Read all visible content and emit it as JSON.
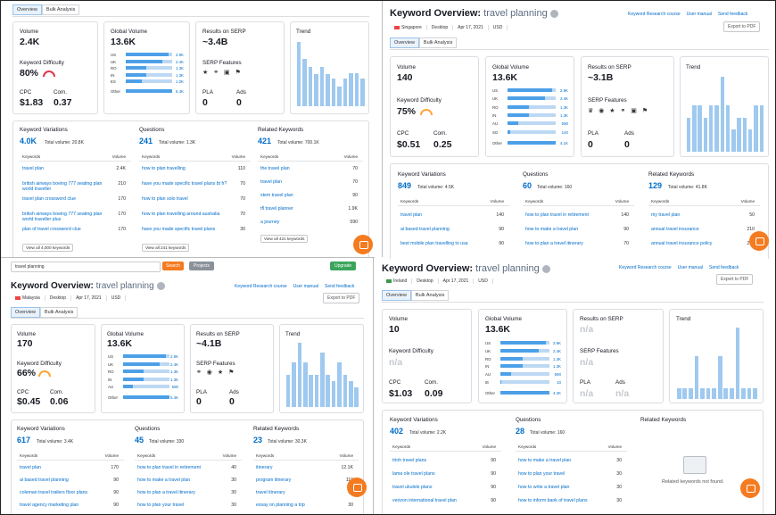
{
  "common": {
    "title_prefix": "Keyword Overview:",
    "keyword": "travel planning",
    "tab_overview": "Overview",
    "tab_bulk": "Bulk Analysis",
    "lbl_volume": "Volume",
    "lbl_global": "Global Volume",
    "lbl_results": "Results on SERP",
    "lbl_trend": "Trend",
    "lbl_kd": "Keyword Difficulty",
    "lbl_serp_features": "SERP Features",
    "lbl_cpc": "CPC",
    "lbl_com": "Com.",
    "lbl_pla": "PLA",
    "lbl_ads": "Ads",
    "lbl_variations": "Keyword Variations",
    "lbl_questions": "Questions",
    "lbl_related": "Related Keywords",
    "col_keywords": "Keywords",
    "col_volume": "Volume",
    "link_research": "Keyword Research course",
    "link_manual": "User manual",
    "link_feedback": "Send feedback",
    "export": "Export to PDF",
    "na": "n/a",
    "other": "Other",
    "icon_names": [
      "search-icon",
      "chat-icon",
      "flag-icon",
      "info-icon",
      "gauge-icon"
    ],
    "colors": {
      "link": "#006dca",
      "bar": "#9fc9ef",
      "gauge_orange": "#ffa43c",
      "gauge_red": "#e0384b",
      "chat": "#f57b20"
    }
  },
  "p1": {
    "volume": "2.4K",
    "global": "13.6K",
    "results": "~3.4B",
    "kd": "80%",
    "cpc": "$1.83",
    "com": "0.37",
    "pla": "0",
    "ads": "0",
    "countries": [
      {
        "code": "US",
        "val": "2.9K",
        "pct": 0.92
      },
      {
        "code": "UK",
        "val": "2.4K",
        "pct": 0.78
      },
      {
        "code": "RO",
        "val": "1.3K",
        "pct": 0.45
      },
      {
        "code": "IN",
        "val": "1.3K",
        "pct": 0.45
      },
      {
        "code": "ES",
        "val": "1.0K",
        "pct": 0.35
      },
      {
        "code": "Other",
        "val": "5.4K",
        "pct": 1.0
      }
    ],
    "trend": [
      0.97,
      0.72,
      0.6,
      0.48,
      0.6,
      0.48,
      0.42,
      0.3,
      0.42,
      0.5,
      0.5,
      0.42
    ],
    "variations": {
      "count": "4.0K",
      "total": "Total volume: 20.8K",
      "rows": [
        {
          "k": "travel plan",
          "v": "2.4K"
        },
        {
          "k": "british airways boeing 777 seating plan world traveller",
          "v": "210"
        },
        {
          "k": "travel plan crossword clue",
          "v": "170"
        },
        {
          "k": "british airways boeing 777 seating plan world traveller plus",
          "v": "170"
        },
        {
          "k": "plan of travel crossword clue",
          "v": "170"
        }
      ],
      "btn": "View all 4,000 keywords"
    },
    "questions": {
      "count": "241",
      "total": "Total volume: 1.3K",
      "rows": [
        {
          "k": "how to plan travelling",
          "v": "110"
        },
        {
          "k": "have you made specific travel plans bt fr?",
          "v": "70"
        },
        {
          "k": "how to plan solo travel",
          "v": "70"
        },
        {
          "k": "how to plan travelling around australia",
          "v": "70"
        },
        {
          "k": "have you made specific travel plans",
          "v": "30"
        }
      ],
      "btn": "View all 241 keywords"
    },
    "related": {
      "count": "421",
      "total": "Total volume: 700.1K",
      "rows": [
        {
          "k": "the travel plan",
          "v": "70"
        },
        {
          "k": "travel plan",
          "v": "70"
        },
        {
          "k": "stem travel plan",
          "v": "90"
        },
        {
          "k": "tfl travel planner",
          "v": "1.9K"
        },
        {
          "k": "a journey",
          "v": "590"
        }
      ],
      "btn": "View all 421 keywords"
    }
  },
  "p2": {
    "filters": [
      "Singapore",
      "Desktop",
      "Apr 17, 2021",
      "USD"
    ],
    "volume": "140",
    "global": "13.6K",
    "results": "~3.1B",
    "kd": "75%",
    "cpc": "$0.51",
    "com": "0.25",
    "pla": "0",
    "ads": "0",
    "countries": [
      {
        "code": "US",
        "val": "2.9K",
        "pct": 0.92
      },
      {
        "code": "UK",
        "val": "2.4K",
        "pct": 0.78
      },
      {
        "code": "RO",
        "val": "1.3K",
        "pct": 0.45
      },
      {
        "code": "IN",
        "val": "1.3K",
        "pct": 0.45
      },
      {
        "code": "AU",
        "val": "590",
        "pct": 0.22
      },
      {
        "code": "SG",
        "val": "140",
        "pct": 0.06
      },
      {
        "code": "Other",
        "val": "4.1K",
        "pct": 1.0
      }
    ],
    "trend": [
      0.45,
      0.62,
      0.62,
      0.45,
      0.62,
      0.62,
      1.0,
      0.62,
      0.3,
      0.45,
      0.45,
      0.3,
      0.62,
      0.62
    ],
    "variations": {
      "count": "849",
      "total": "Total volume: 4.5K",
      "rows": [
        {
          "k": "travel plan",
          "v": "140"
        },
        {
          "k": "ai based travel planning",
          "v": "90"
        },
        {
          "k": "best mobile plan travelling to usa",
          "v": "90"
        }
      ]
    },
    "questions": {
      "count": "60",
      "total": "Total volume: 160",
      "rows": [
        {
          "k": "how to plan travel in retirement",
          "v": "140"
        },
        {
          "k": "how to make a travel plan",
          "v": "90"
        },
        {
          "k": "how to plan a travel itinerary",
          "v": "70"
        }
      ]
    },
    "related": {
      "count": "129",
      "total": "Total volume: 41.8K",
      "rows": [
        {
          "k": "my travel plan",
          "v": "50"
        },
        {
          "k": "annual travel insurance",
          "v": "210"
        },
        {
          "k": "annual travel insurance policy",
          "v": "210"
        }
      ]
    }
  },
  "p3": {
    "search_value": "travel planning",
    "search_btn": "Search",
    "projects_btn": "Projects",
    "upgrade_btn": "Upgrade",
    "filters": [
      "Malaysia",
      "Desktop",
      "Apr 17, 2021",
      "USD"
    ],
    "volume": "170",
    "global": "13.6K",
    "results": "~4.1B",
    "kd": "66%",
    "cpc": "$0.45",
    "com": "0.06",
    "pla": "0",
    "ads": "0",
    "countries": [
      {
        "code": "US",
        "val": "2.9K",
        "pct": 0.92
      },
      {
        "code": "UK",
        "val": "2.4K",
        "pct": 0.78
      },
      {
        "code": "RO",
        "val": "1.3K",
        "pct": 0.45
      },
      {
        "code": "IN",
        "val": "1.3K",
        "pct": 0.45
      },
      {
        "code": "AU",
        "val": "590",
        "pct": 0.22
      },
      {
        "code": "Other",
        "val": "5.4K",
        "pct": 1.0
      }
    ],
    "trend": [
      0.5,
      0.7,
      1.0,
      0.7,
      0.5,
      0.5,
      0.85,
      0.5,
      0.4,
      0.7,
      0.5,
      0.4,
      0.3
    ],
    "variations": {
      "count": "617",
      "total": "Total volume: 3.4K",
      "rows": [
        {
          "k": "travel plan",
          "v": "170"
        },
        {
          "k": "ai based travel planning",
          "v": "90"
        },
        {
          "k": "coleman travel trailers floor plans",
          "v": "90"
        },
        {
          "k": "travel agency marketing plan",
          "v": "90"
        }
      ]
    },
    "questions": {
      "count": "45",
      "total": "Total volume: 330",
      "rows": [
        {
          "k": "how to plan travel in retirement",
          "v": "40"
        },
        {
          "k": "how to make a travel plan",
          "v": "30"
        },
        {
          "k": "how to plan a travel itinerary",
          "v": "30"
        },
        {
          "k": "how to plan your travel",
          "v": "30"
        }
      ]
    },
    "related": {
      "count": "23",
      "total": "Total volume: 30.3K",
      "rows": [
        {
          "k": "itinerary",
          "v": "12.1K"
        },
        {
          "k": "program itinerary",
          "v": "110"
        },
        {
          "k": "travel itinerary",
          "v": "90"
        },
        {
          "k": "essay on planning a trip",
          "v": "30"
        }
      ]
    }
  },
  "p4": {
    "filters": [
      "Ireland",
      "Desktop",
      "Apr 17, 2021",
      "USD"
    ],
    "volume": "10",
    "global": "13.6K",
    "results": "n/a",
    "kd": "n/a",
    "cpc": "$1.03",
    "com": "0.09",
    "pla": "n/a",
    "ads": "n/a",
    "countries": [
      {
        "code": "US",
        "val": "2.9K",
        "pct": 0.92
      },
      {
        "code": "UK",
        "val": "2.4K",
        "pct": 0.78
      },
      {
        "code": "RO",
        "val": "1.3K",
        "pct": 0.45
      },
      {
        "code": "IN",
        "val": "1.3K",
        "pct": 0.45
      },
      {
        "code": "AU",
        "val": "590",
        "pct": 0.22
      },
      {
        "code": "IE",
        "val": "10",
        "pct": 0.02
      },
      {
        "code": "Other",
        "val": "4.2K",
        "pct": 1.0
      }
    ],
    "trend": [
      0.15,
      0.15,
      0.15,
      0.6,
      0.15,
      0.15,
      0.15,
      0.6,
      0.15,
      0.15,
      1.0,
      0.15,
      0.15,
      0.15
    ],
    "variations": {
      "count": "402",
      "total": "Total volume: 2.2K",
      "rows": [
        {
          "k": "trinh travel plans",
          "v": "90"
        },
        {
          "k": "lama ole travel plans",
          "v": "90"
        },
        {
          "k": "travel ukulele plans",
          "v": "90"
        },
        {
          "k": "verizon international travel plan",
          "v": "90"
        }
      ]
    },
    "questions": {
      "count": "28",
      "total": "Total volume: 160",
      "rows": [
        {
          "k": "how to make a travel plan",
          "v": "30"
        },
        {
          "k": "how to plan your travel",
          "v": "30"
        },
        {
          "k": "how to write a travel plan",
          "v": "30"
        },
        {
          "k": "how to inform bank of travel plans",
          "v": "30"
        }
      ]
    },
    "related_empty": "Related keywords not found."
  }
}
